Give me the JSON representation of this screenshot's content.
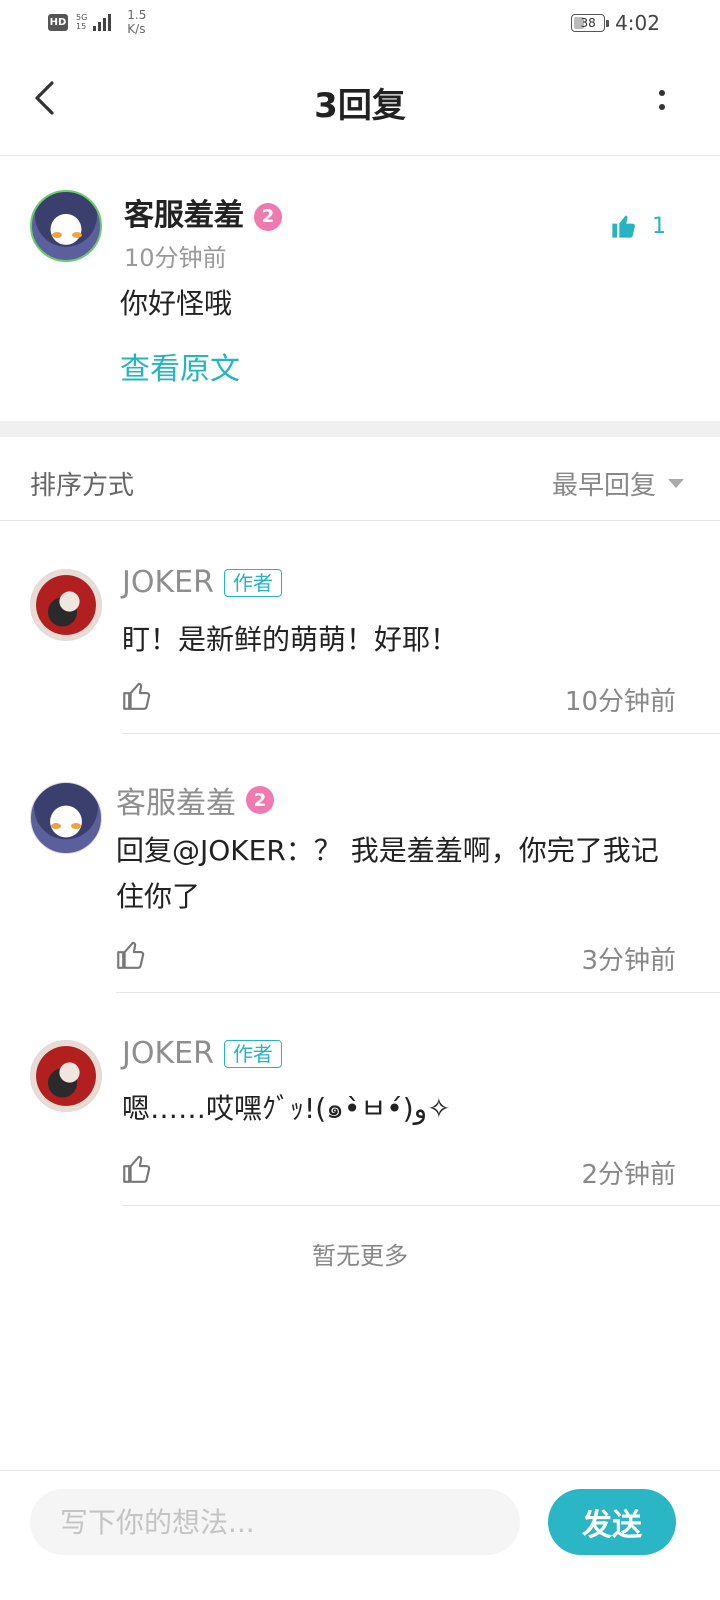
{
  "status_bar": {
    "hd": "HD",
    "network_top": "5G",
    "network_bottom": "15",
    "speed_value": "1.5",
    "speed_unit": "K/s",
    "battery": "38",
    "time": "4:02"
  },
  "header": {
    "title": "3回复"
  },
  "main_comment": {
    "author": "客服羞羞",
    "level": "2",
    "time": "10分钟前",
    "text": "你好怪哦",
    "view_original": "查看原文",
    "like_count": "1",
    "accent_color": "#27b4c2"
  },
  "sort": {
    "label": "排序方式",
    "value": "最早回复"
  },
  "replies": [
    {
      "author": "JOKER",
      "tag": "作者",
      "text": "盯！是新鲜的萌萌！好耶！",
      "time": "10分钟前"
    },
    {
      "author": "客服羞羞",
      "level": "2",
      "text": "回复@JOKER：？ 我是羞羞啊，你完了我记住你了",
      "time": "3分钟前"
    },
    {
      "author": "JOKER",
      "tag": "作者",
      "text": "嗯……哎嘿ｸﾞｯ!(๑•̀ㅂ•́)و✧",
      "time": "2分钟前"
    }
  ],
  "footer": {
    "no_more": "暂无更多"
  },
  "composer": {
    "placeholder": "写下你的想法...",
    "send_label": "发送"
  }
}
